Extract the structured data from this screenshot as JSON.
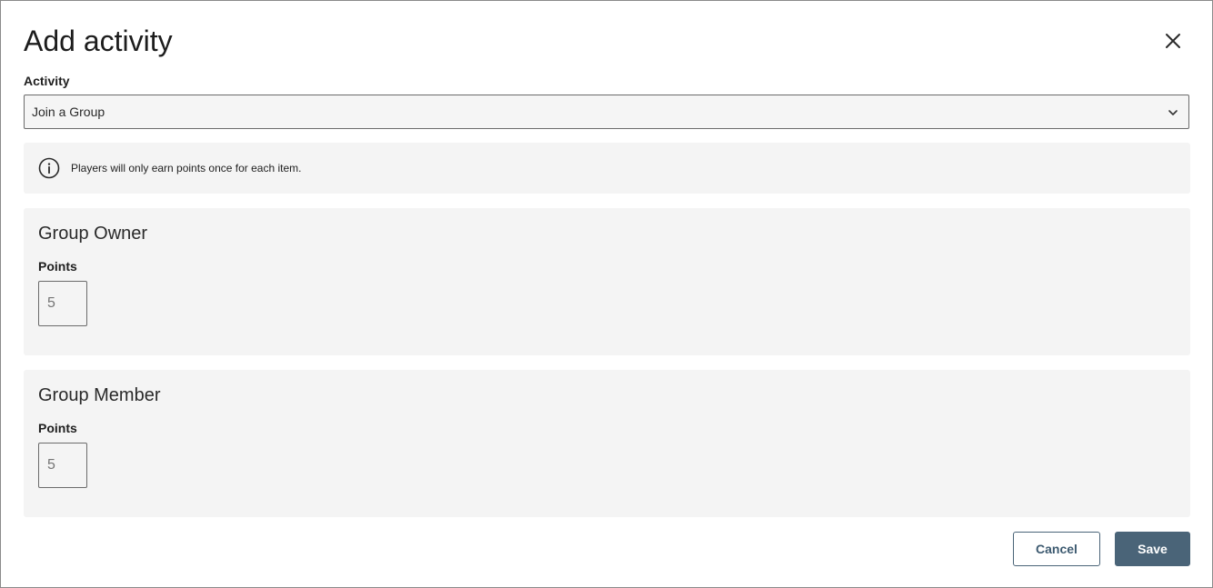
{
  "dialog": {
    "title": "Add activity",
    "close_icon": "close-icon"
  },
  "activity": {
    "label": "Activity",
    "selected": "Join a Group",
    "chevron_icon": "chevron-down-icon"
  },
  "info": {
    "icon": "info-icon",
    "text": "Players will only earn points once for each item."
  },
  "groups": [
    {
      "title": "Group Owner",
      "points_label": "Points",
      "points_placeholder": "5"
    },
    {
      "title": "Group Member",
      "points_label": "Points",
      "points_placeholder": "5"
    }
  ],
  "footer": {
    "cancel_label": "Cancel",
    "save_label": "Save"
  },
  "colors": {
    "primary": "#4a6478",
    "panel_bg": "#f4f4f4",
    "border": "#6b6b6b"
  }
}
